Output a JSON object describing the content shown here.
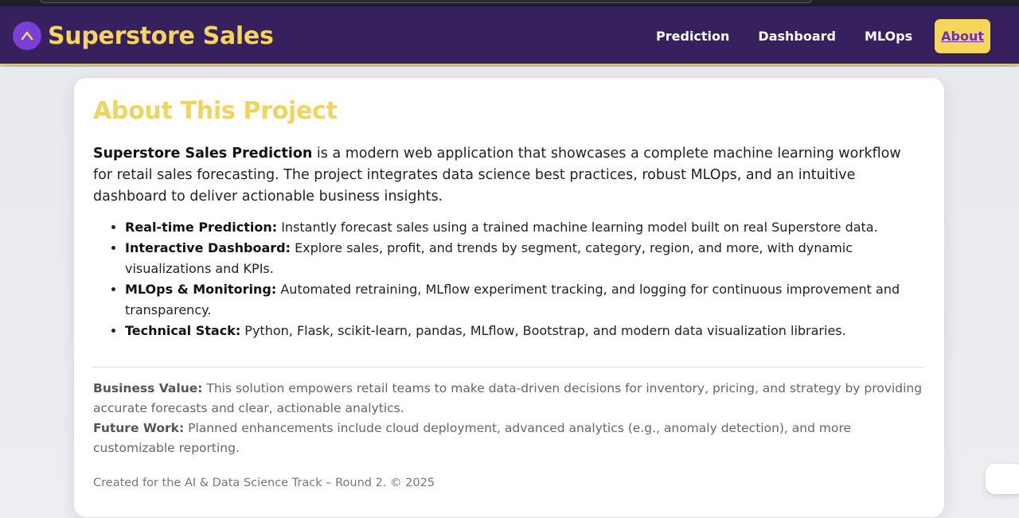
{
  "navbar": {
    "brand_title": "Superstore Sales",
    "links": [
      {
        "label": "Prediction"
      },
      {
        "label": "Dashboard"
      },
      {
        "label": "MLOps"
      },
      {
        "label": "About"
      }
    ],
    "active_link": "About"
  },
  "about": {
    "heading": "About This Project",
    "intro_bold": "Superstore Sales Prediction",
    "intro_text": " is a modern web application that showcases a complete machine learning workflow for retail sales forecasting. The project integrates data science best practices, robust MLOps, and an intuitive dashboard to deliver actionable business insights.",
    "features": [
      {
        "title": "Real-time Prediction:",
        "text": " Instantly forecast sales using a trained machine learning model built on real Superstore data."
      },
      {
        "title": "Interactive Dashboard:",
        "text": " Explore sales, profit, and trends by segment, category, region, and more, with dynamic visualizations and KPIs."
      },
      {
        "title": "MLOps & Monitoring:",
        "text": " Automated retraining, MLflow experiment tracking, and logging for continuous improvement and transparency."
      },
      {
        "title": "Technical Stack:",
        "text": " Python, Flask, scikit-learn, pandas, MLflow, Bootstrap, and modern data visualization libraries."
      }
    ],
    "business_value_label": "Business Value:",
    "business_value_text": " This solution empowers retail teams to make data-driven decisions for inventory, pricing, and strategy by providing accurate forecasts and clear, actionable analytics.",
    "future_work_label": "Future Work:",
    "future_work_text": " Planned enhancements include cloud deployment, advanced analytics (e.g., anomaly detection), and more customizable reporting.",
    "footer": "Created for the AI & Data Science Track – Round 2. © 2025"
  },
  "colors": {
    "navbar_bg": "#36215e",
    "accent_yellow": "#f5d55a",
    "brand_icon_bg": "#7a3fd6"
  },
  "icons": {
    "brand": "chevron-up-icon",
    "chat": "chat-bubble-icon"
  }
}
